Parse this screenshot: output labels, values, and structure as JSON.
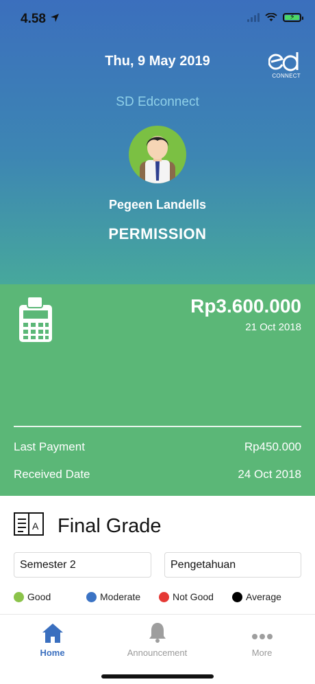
{
  "status_bar": {
    "time": "4.58"
  },
  "header": {
    "date": "Thu, 9 May 2019",
    "logo_text": "CONNECT",
    "school": "SD Edconnect",
    "student_name": "Pegeen Landells",
    "status": "PERMISSION"
  },
  "payment": {
    "amount": "Rp3.600.000",
    "due_date": "21 Oct 2018",
    "last_payment_label": "Last Payment",
    "last_payment_value": "Rp450.000",
    "received_label": "Received Date",
    "received_value": "24 Oct 2018"
  },
  "grade": {
    "title": "Final Grade",
    "semester": "Semester 2",
    "category": "Pengetahuan",
    "legend": [
      {
        "label": "Good",
        "color": "#8bc34a"
      },
      {
        "label": "Moderate",
        "color": "#3b73c4"
      },
      {
        "label": "Not Good",
        "color": "#e53935"
      },
      {
        "label": "Average",
        "color": "#000000"
      }
    ]
  },
  "tabs": [
    {
      "label": "Home",
      "active": true
    },
    {
      "label": "Announcement",
      "active": false
    },
    {
      "label": "More",
      "active": false
    }
  ],
  "colors": {
    "accent": "#3a6fbf",
    "payment_bg": "#5bb777"
  }
}
